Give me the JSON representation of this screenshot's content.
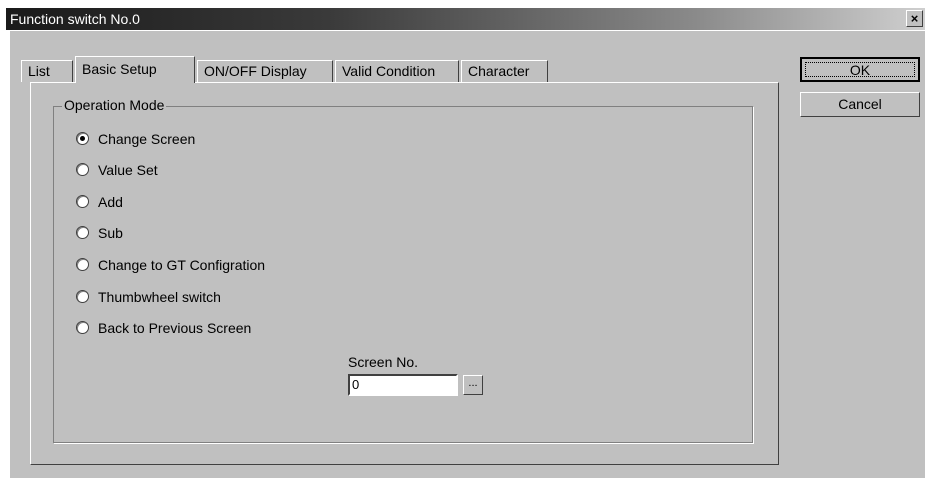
{
  "window": {
    "title": "Function switch No.0",
    "close_glyph": "×"
  },
  "tabs": [
    {
      "label": "List"
    },
    {
      "label": "Basic Setup",
      "active": true
    },
    {
      "label": "ON/OFF Display"
    },
    {
      "label": "Valid Condition"
    },
    {
      "label": "Character"
    }
  ],
  "operation_mode": {
    "group_label": "Operation Mode",
    "options": [
      {
        "label": "Change Screen",
        "selected": true
      },
      {
        "label": "Value Set",
        "selected": false
      },
      {
        "label": "Add",
        "selected": false
      },
      {
        "label": "Sub",
        "selected": false
      },
      {
        "label": "Change to GT Configration",
        "selected": false
      },
      {
        "label": "Thumbwheel switch",
        "selected": false
      },
      {
        "label": "Back to Previous Screen",
        "selected": false
      }
    ]
  },
  "screen_no": {
    "label": "Screen No.",
    "value": "0",
    "browse_label": "..."
  },
  "buttons": {
    "ok": "OK",
    "cancel": "Cancel"
  }
}
